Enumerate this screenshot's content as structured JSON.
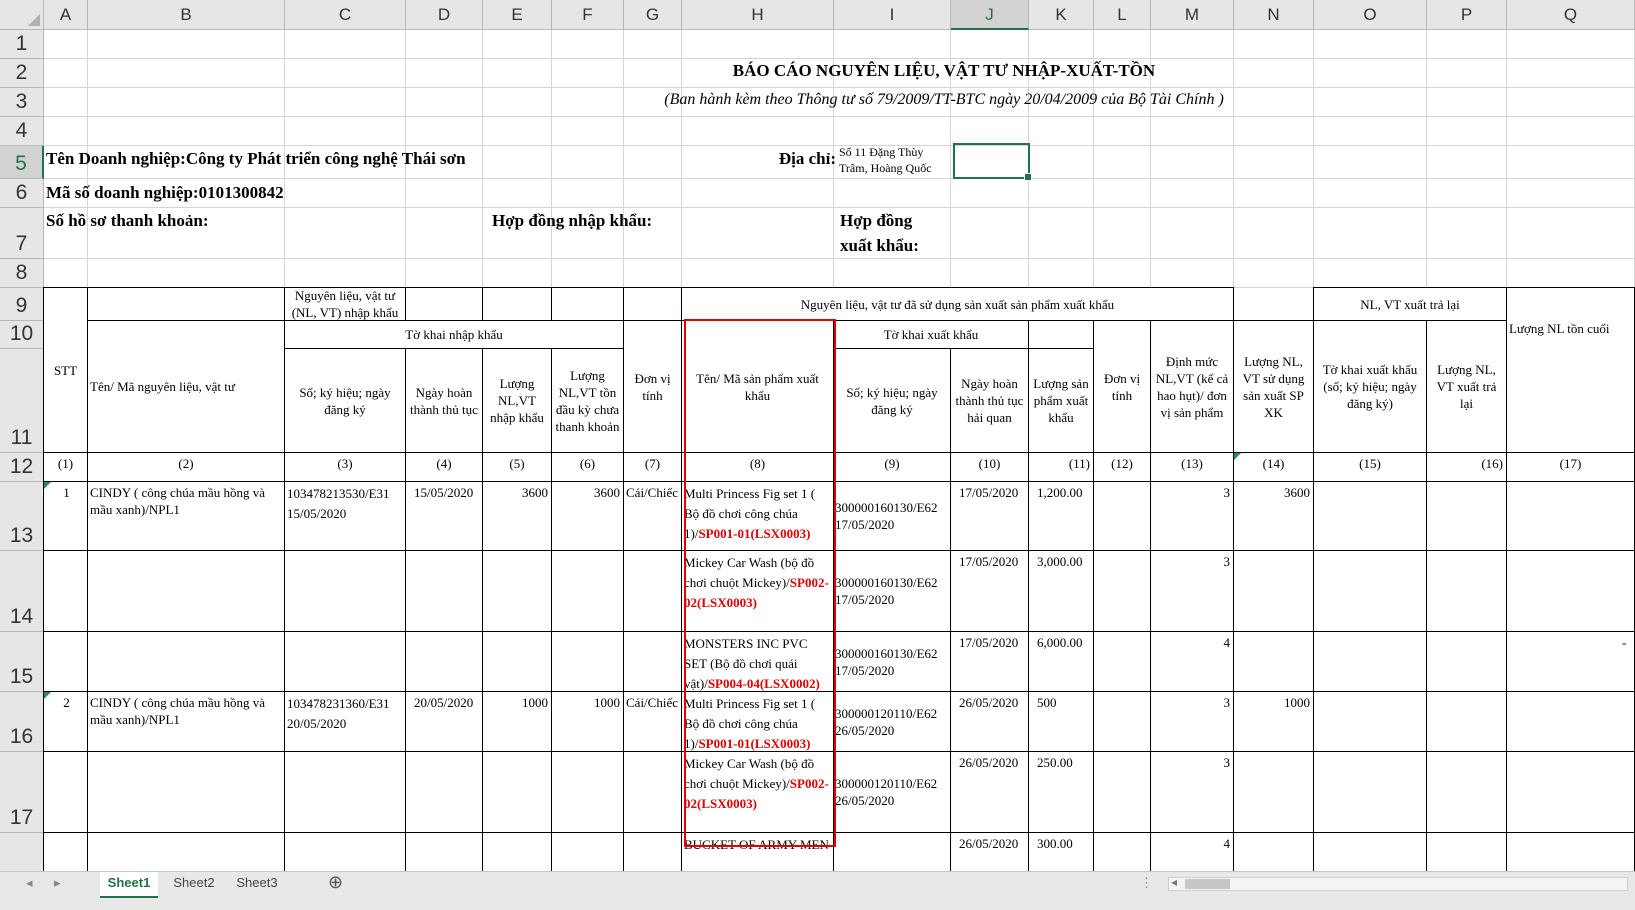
{
  "columns": [
    "A",
    "B",
    "C",
    "D",
    "E",
    "F",
    "G",
    "H",
    "I",
    "J",
    "K",
    "L",
    "M",
    "N",
    "O",
    "P",
    "Q"
  ],
  "rows": [
    "1",
    "2",
    "3",
    "4",
    "5",
    "6",
    "7",
    "8",
    "9",
    "10",
    "11",
    "12",
    "13",
    "14",
    "15",
    "16",
    "17"
  ],
  "selected_cell": {
    "col": "J",
    "row": "5"
  },
  "report": {
    "title": "BÁO CÁO NGUYÊN LIỆU, VẬT TƯ NHẬP-XUẤT-TỒN",
    "subtitle": "(Ban hành kèm theo Thông tư số 79/2009/TT-BTC ngày 20/04/2009 của Bộ Tài Chính )",
    "company": "Tên Doanh nghiệp:Công ty Phát triển công nghệ Thái sơn",
    "address_label": "Địa chỉ:",
    "address_value": "Số 11 Đặng Thùy Trâm, Hoàng Quốc",
    "tax_code": "Mã số doanh nghiệp:0101300842",
    "dossier": "Số hồ sơ thanh khoản:",
    "import_contract": "Hợp đồng nhập khẩu:",
    "export_contract": "Hợp đồng xuất khẩu:"
  },
  "headers": {
    "stt": "STT",
    "material": "Tên/ Mã nguyên liệu, vật tư",
    "import_group": "Nguyên liệu, vật tư (NL, VT) nhập khẩu",
    "import_decl": "Tờ khai nhập khẩu",
    "import_no": "Số; ký hiệu; ngày đăng ký",
    "import_date": "Ngày hoàn thành thủ tục",
    "import_qty": "Lượng NL,VT nhập khẩu",
    "remain_qty": "Lượng NL,VT tồn đầu kỳ chưa thanh khoản",
    "unit": "Đơn vị tính",
    "used_group": "Nguyên liệu, vật tư đã sử dụng sản xuất sản phẩm xuất khẩu",
    "product": "Tên/ Mã sản phẩm xuất khẩu",
    "export_decl": "Tờ khai xuất khẩu",
    "export_no": "Số; ký hiệu; ngày đăng ký",
    "export_date": "Ngày hoàn thành thủ tục hải quan",
    "export_qty": "Lượng sản phẩm xuất khẩu",
    "unit2": "Đơn vị tính",
    "norm": "Định mức NL,VT (kể cả hao hụt)/ đơn vị sản phẩm",
    "used_qty": "Lượng NL, VT sử dụng sản xuất SP XK",
    "returned_group": "NL, VT xuất trả lại",
    "ret_decl": "Tờ khai xuất khẩu (số; ký hiệu; ngày đăng ký)",
    "ret_qty": "Lượng NL, VT xuất trả lại",
    "end_qty": "Lượng NL tồn cuối"
  },
  "col_numbers": [
    "(1)",
    "(2)",
    "(3)",
    "(4)",
    "(5)",
    "(6)",
    "(7)",
    "(8)",
    "(9)",
    "(10)",
    "(11)",
    "(12)",
    "(13)",
    "(14)",
    "(15)",
    "(16)",
    "(17)"
  ],
  "data_rows": [
    {
      "stt": "1",
      "material": "CINDY ( công chúa mầu hồng và mầu xanh)/NPL1",
      "imp_no": "103478213530/E31 15/05/2020",
      "imp_date": "15/05/2020",
      "imp_qty": "3600",
      "remain": "3600",
      "unit": "Cái/Chiếc",
      "prod_text": "Multi Princess Fig set 1 ( Bộ đồ chơi công chúa 1)/",
      "prod_code": "SP001-01(LSX0003)",
      "exp_no": "300000160130/E62 17/05/2020",
      "exp_date": "17/05/2020",
      "exp_qty": "1,200.00",
      "norm": "3",
      "used": "3600"
    },
    {
      "stt": "",
      "material": "",
      "imp_no": "",
      "imp_date": "",
      "imp_qty": "",
      "remain": "",
      "unit": "",
      "prod_text": "Mickey Car Wash (bộ đồ chơi chuột Mickey)/",
      "prod_code": "SP002-02(LSX0003)",
      "exp_no": "300000160130/E62 17/05/2020",
      "exp_date": "17/05/2020",
      "exp_qty": "3,000.00",
      "norm": "3",
      "used": ""
    },
    {
      "stt": "",
      "material": "",
      "imp_no": "",
      "imp_date": "",
      "imp_qty": "",
      "remain": "",
      "unit": "",
      "prod_text": "MONSTERS INC PVC SET (Bộ đồ chơi quái vật)/",
      "prod_code": "SP004-04(LSX0002)",
      "exp_no": "300000160130/E62 17/05/2020",
      "exp_date": "17/05/2020",
      "exp_qty": "6,000.00",
      "norm": "4",
      "used": ""
    },
    {
      "stt": "2",
      "material": "CINDY ( công chúa mầu hồng và mầu xanh)/NPL1",
      "imp_no": "103478231360/E31 20/05/2020",
      "imp_date": "20/05/2020",
      "imp_qty": "1000",
      "remain": "1000",
      "unit": "Cái/Chiếc",
      "prod_text": "Multi Princess Fig set 1 ( Bộ đồ chơi công chúa 1)/",
      "prod_code": "SP001-01(LSX0003)",
      "exp_no": "300000120110/E62 26/05/2020",
      "exp_date": "26/05/2020",
      "exp_qty": "500",
      "norm": "3",
      "used": "1000"
    },
    {
      "stt": "",
      "material": "",
      "imp_no": "",
      "imp_date": "",
      "imp_qty": "",
      "remain": "",
      "unit": "",
      "prod_text": "Mickey Car Wash (bộ đồ chơi chuột Mickey)/",
      "prod_code": "SP002-02(LSX0003)",
      "exp_no": "300000120110/E62 26/05/2020",
      "exp_date": "26/05/2020",
      "exp_qty": "250.00",
      "norm": "3",
      "used": ""
    },
    {
      "stt": "",
      "material": "",
      "imp_no": "",
      "imp_date": "",
      "imp_qty": "",
      "remain": "",
      "unit": "",
      "prod_text": "BUCKET OF ARMY MEN",
      "prod_code": "",
      "exp_no": "",
      "exp_date": "26/05/2020",
      "exp_qty": "300.00",
      "norm": "4",
      "used": ""
    }
  ],
  "dash": "-",
  "sheet_tabs": [
    "Sheet1",
    "Sheet2",
    "Sheet3"
  ],
  "active_sheet": "Sheet1",
  "nav": {
    "prev": "◂",
    "next": "▸",
    "add": "⊕",
    "scroll_left": "◂",
    "options": "⋮"
  }
}
